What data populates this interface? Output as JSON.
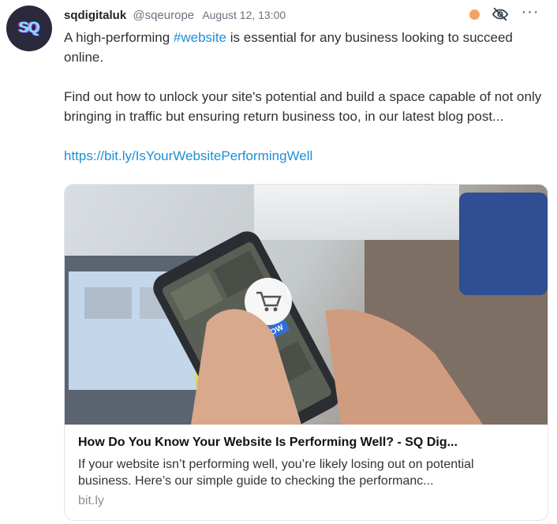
{
  "post": {
    "avatar_text": "SQ",
    "display_name": "sqdigitaluk",
    "handle": "@sqeurope",
    "timestamp": "August 12, 13:00",
    "status_color": "#f6a15e",
    "icons": [
      "eye-off-icon",
      "more-icon"
    ],
    "more_label": "···",
    "text_line1_pre": "A high-performing ",
    "hashtag": "#website",
    "text_line1_post": " is essential for any business looking to succeed online.",
    "text_paragraph2": "Find out how to unlock your site's potential and build a space capable of not only bringing in traffic but ensuring return business too, in our latest blog post...",
    "link": "https://bit.ly/IsYourWebsitePerformingWell",
    "link_color": "#1d8fd6"
  },
  "card": {
    "image_text": "BUY NOW",
    "title": "How Do You Know Your Website Is Performing Well? - SQ Dig...",
    "description": "If your website isn’t performing well, you’re likely losing out on potential business. Here’s our simple guide to checking the performanc...",
    "domain": "bit.ly"
  }
}
